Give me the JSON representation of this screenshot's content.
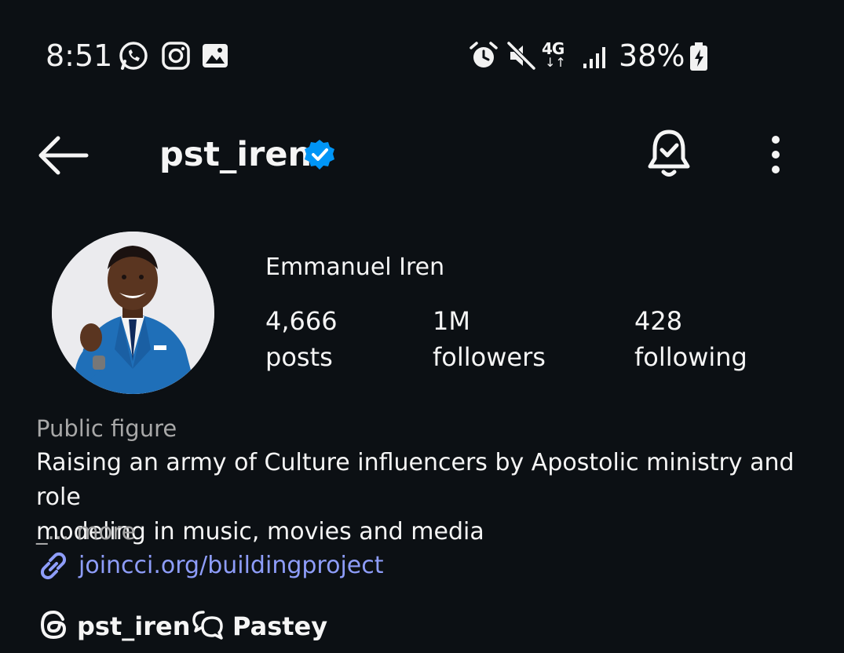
{
  "status_bar": {
    "time": "8:51",
    "left_icons": [
      "whatsapp-icon",
      "instagram-icon",
      "gallery-icon"
    ],
    "right_icons": [
      "alarm-icon",
      "mute-icon",
      "network-4g-lte-icon",
      "signal-icon",
      "battery-charging-icon"
    ],
    "network_label": "4G",
    "battery": "38%"
  },
  "header": {
    "username": "pst_iren",
    "verified": true,
    "accent_color": "#0095f6"
  },
  "profile": {
    "full_name": "Emmanuel Iren",
    "stats": [
      {
        "value": "4,666",
        "label": "posts"
      },
      {
        "value": "1M",
        "label": "followers"
      },
      {
        "value": "428",
        "label": "following"
      }
    ],
    "category": "Public figure",
    "bio_line1": "Raising an army of Culture influencers by Apostolic ministry and role",
    "bio_line2": "modeling in music, movies and media",
    "more_prefix": "_",
    "more_label": "... more",
    "link": "joincci.org/buildingproject",
    "link_color": "#8e9dfa"
  },
  "chips": [
    {
      "icon": "threads-icon",
      "label": "pst_iren"
    },
    {
      "icon": "chat-bubbles-icon",
      "label": "Pastey"
    }
  ]
}
